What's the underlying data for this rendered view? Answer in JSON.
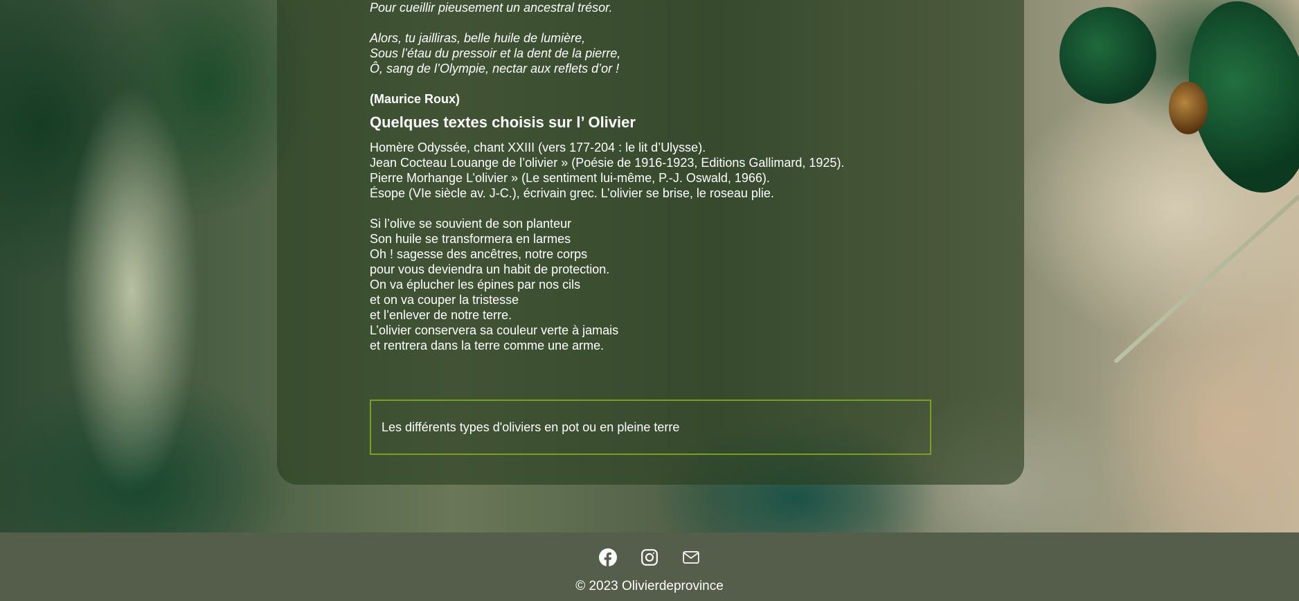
{
  "poem_1": {
    "lines_a": [
      "Pour cueillir pieusement un ancestral trésor."
    ],
    "lines_b": [
      "Alors, tu jailliras, belle huile de lumière,",
      "Sous l’étau du pressoir et la dent de la pierre,",
      "Ô, sang de l’Olympie, nectar aux reflets d’or !"
    ],
    "author": "(Maurice Roux)"
  },
  "texts_section": {
    "heading": "Quelques textes choisis sur l’ Olivier",
    "references": [
      "Homère Odyssée, chant XXIII  (vers 177-204 : le lit d’Ulysse).",
      "Jean Cocteau Louange de l’olivier  » (Poésie de 1916-1923, Editions Gallimard, 1925).",
      "Pierre Morhange L’olivier  » (Le sentiment lui-même, P.-J. Oswald, 1966).",
      "Ésope  (VIe siècle av. J-C.), écrivain grec. L’olivier se brise, le roseau plie."
    ]
  },
  "poem_2": {
    "lines": [
      "Si l’olive se souvient de son planteur",
      "Son huile se transformera en larmes",
      "Oh ! sagesse des ancêtres, notre corps",
      "pour vous deviendra un habit de protection.",
      "On va éplucher les épines par nos cils",
      "et on va couper la tristesse",
      "et l’enlever de notre terre.",
      "L’olivier conservera sa couleur verte à jamais",
      "et rentrera dans la terre comme une arme."
    ]
  },
  "link_box": {
    "label": "Les différents types d'oliviers en pot ou en pleine terre"
  },
  "footer": {
    "icons": [
      "facebook-icon",
      "instagram-icon",
      "mail-icon"
    ],
    "copyright": "© 2023 Olivierdeprovince",
    "background_color": "#545e4a"
  },
  "colors": {
    "link_box_border": "#7aa01e",
    "text": "#ffffff"
  }
}
